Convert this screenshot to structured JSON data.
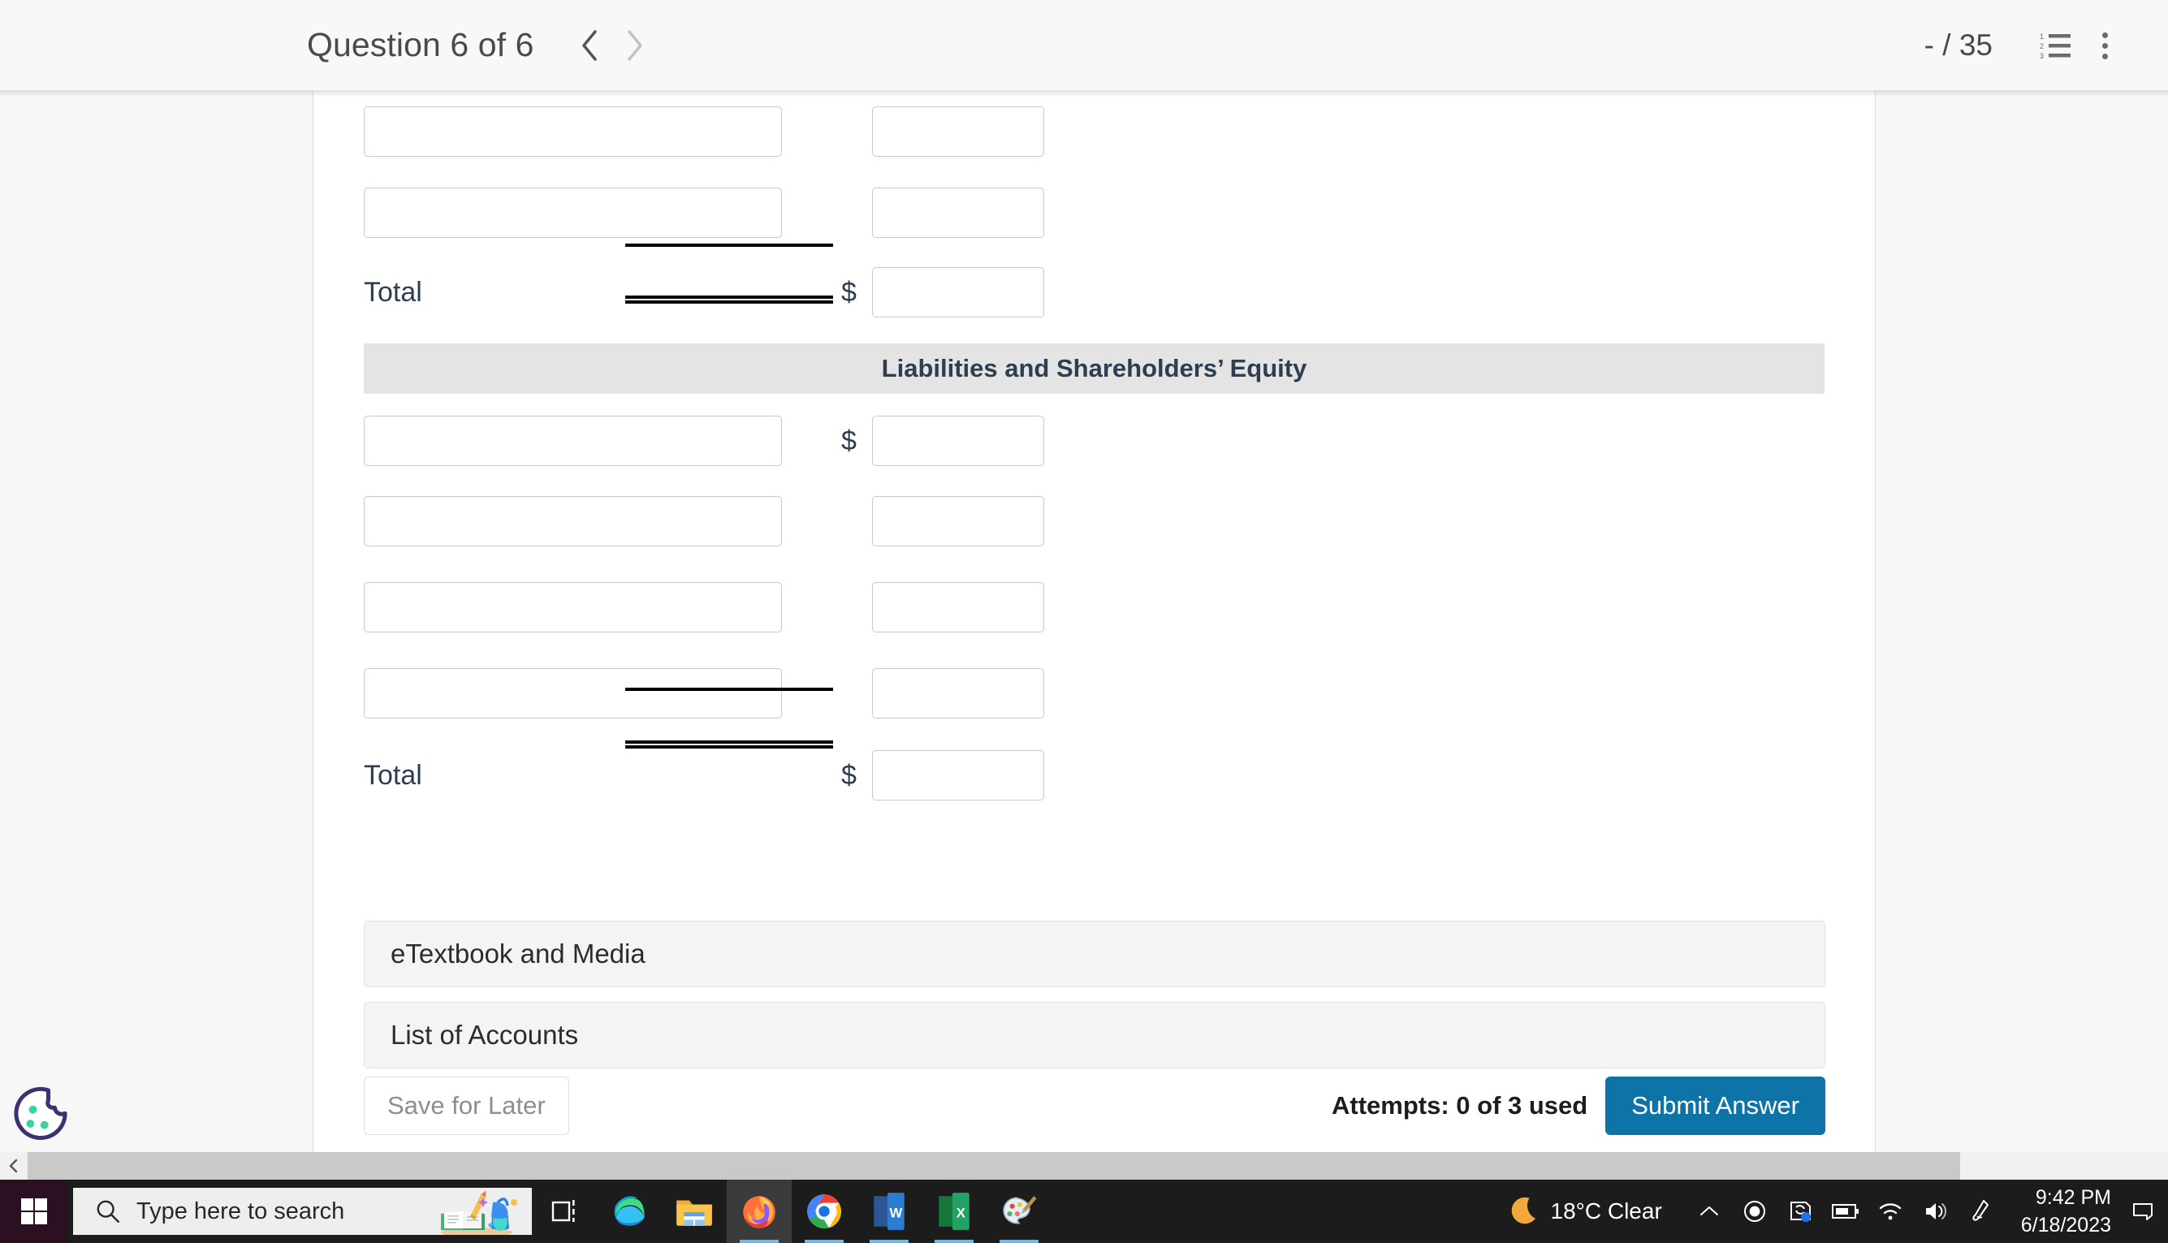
{
  "header": {
    "question_title": "Question 6 of 6",
    "prev_label": "Previous question",
    "next_label": "Next question",
    "score": "- / 35",
    "list_icon": "numbered-list-icon",
    "menu_icon": "kebab-menu-icon"
  },
  "ledger": {
    "assets_rows": [
      {
        "account": "",
        "amount": "",
        "show_dollar": false
      },
      {
        "account": "",
        "amount": "",
        "show_dollar": false
      }
    ],
    "assets_total": {
      "label": "Total",
      "amount": "",
      "dollar": "$"
    },
    "section_band_title": "Liabilities and Shareholders’ Equity",
    "liabilities_rows": [
      {
        "account": "",
        "amount": "",
        "show_dollar": true
      },
      {
        "account": "",
        "amount": "",
        "show_dollar": false
      },
      {
        "account": "",
        "amount": "",
        "show_dollar": false
      },
      {
        "account": "",
        "amount": "",
        "show_dollar": false
      }
    ],
    "liabilities_total": {
      "label": "Total",
      "amount": "",
      "dollar": "$"
    },
    "input_placeholder": ""
  },
  "panels": [
    {
      "title": "eTextbook and Media"
    },
    {
      "title": "List of Accounts"
    }
  ],
  "footer": {
    "save_label": "Save for Later",
    "attempts": "Attempts: 0 of 3 used",
    "submit_label": "Submit Answer"
  },
  "cookie_badge": {
    "name": "cookie-consent-icon"
  },
  "scrollbar": {
    "left_arrow": "‹"
  },
  "taskbar": {
    "start": "start-button",
    "search_placeholder": "Type here to search",
    "apps": [
      {
        "name": "task-view",
        "open": false,
        "active": false
      },
      {
        "name": "microsoft-edge",
        "open": false,
        "active": false
      },
      {
        "name": "file-explorer",
        "open": false,
        "active": false
      },
      {
        "name": "firefox",
        "open": true,
        "active": true
      },
      {
        "name": "google-chrome",
        "open": true,
        "active": false
      },
      {
        "name": "microsoft-word",
        "open": true,
        "active": false
      },
      {
        "name": "microsoft-excel",
        "open": true,
        "active": false
      },
      {
        "name": "paint",
        "open": true,
        "active": false
      }
    ],
    "weather": "18°C  Clear",
    "tray_icons": [
      "show-hidden-icons-chevron",
      "record-icon",
      "onedrive-icon",
      "battery-icon",
      "wifi-icon",
      "volume-icon",
      "pen-icon"
    ],
    "time": "9:42 PM",
    "date": "6/18/2023"
  },
  "colors": {
    "submit_blue": "#0e74a8",
    "band_gray": "#e4e4e4",
    "panel_gray": "#f4f4f4",
    "taskbar_dark": "#1c1c1c"
  }
}
